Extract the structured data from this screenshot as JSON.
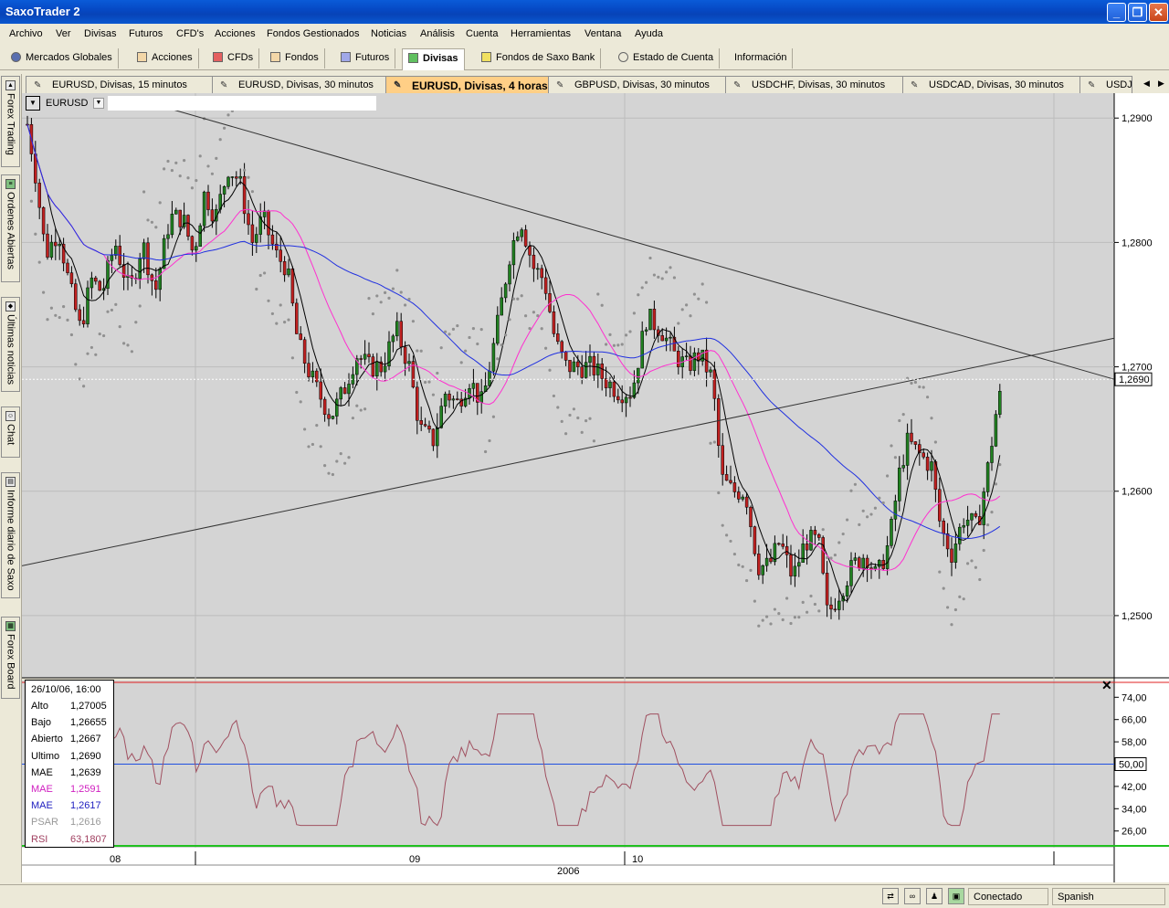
{
  "window": {
    "title": "SaxoTrader 2",
    "buttons": [
      "_",
      "❐",
      "✕"
    ]
  },
  "menu": [
    "Archivo",
    "Ver",
    "Divisas",
    "Futuros",
    "CFD's",
    "Acciones",
    "Fondos Gestionados",
    "Noticias",
    "Análisis",
    "Cuenta",
    "Herramientas",
    "Ventana",
    "Ayuda"
  ],
  "categories": [
    {
      "label": "Mercados Globales",
      "icon": "globe-icon",
      "color": "#5a6fb0"
    },
    {
      "label": "Acciones",
      "icon": "stocks-icon",
      "color": "#c08040"
    },
    {
      "label": "CFDs",
      "icon": "cfd-icon",
      "color": "#d04040"
    },
    {
      "label": "Fondos",
      "icon": "funds-icon",
      "color": "#c08040"
    },
    {
      "label": "Futuros",
      "icon": "futures-icon",
      "color": "#4050c0"
    },
    {
      "label": "Divisas",
      "icon": "forex-icon",
      "color": "#30a030",
      "active": true
    },
    {
      "label": "Fondos de Saxo Bank",
      "icon": "saxo-funds-icon",
      "color": "#d0c040"
    },
    {
      "label": "Estado de Cuenta",
      "icon": "account-icon",
      "color": "#555555"
    },
    {
      "label": "Información",
      "icon": "",
      "color": ""
    }
  ],
  "chart_tabs": [
    {
      "label": "EURUSD, Divisas, 15 minutos"
    },
    {
      "label": "EURUSD, Divisas, 30 minutos"
    },
    {
      "label": "EURUSD, Divisas, 4 horas",
      "active": true
    },
    {
      "label": "GBPUSD, Divisas, 30 minutos"
    },
    {
      "label": "USDCHF, Divisas, 30 minutos"
    },
    {
      "label": "USDCAD, Divisas, 30 minutos"
    },
    {
      "label": "USDJPY, Divisas, 30 minutos"
    }
  ],
  "side_tabs": [
    "Forex Trading",
    "Ordenes Abiertas",
    "Últimas noticias",
    "Chat",
    "Informe diario de Saxo",
    "Forex Board"
  ],
  "symbol": {
    "name": "EURUSD"
  },
  "info_panel": {
    "datetime": "26/10/06, 16:00",
    "rows": [
      {
        "label": "Alto",
        "value": "1,27005",
        "color": "#000000"
      },
      {
        "label": "Bajo",
        "value": "1,26655",
        "color": "#000000"
      },
      {
        "label": "Abierto",
        "value": "1,2667",
        "color": "#000000"
      },
      {
        "label": "Ultimo",
        "value": "1,2690",
        "color": "#000000"
      },
      {
        "label": "MAE",
        "value": "1,2639",
        "color": "#000000"
      },
      {
        "label": "MAE",
        "value": "1,2591",
        "color": "#d020c0"
      },
      {
        "label": "MAE",
        "value": "1,2617",
        "color": "#2020c0"
      },
      {
        "label": "PSAR",
        "value": "1,2616",
        "color": "#999999"
      },
      {
        "label": "RSI",
        "value": "63,1807",
        "color": "#a04060"
      }
    ]
  },
  "price_axis": {
    "ticks": [
      "1,2900",
      "1,2800",
      "1,2700",
      "1,2600",
      "1,2500"
    ],
    "current": "1,2690"
  },
  "rsi_axis": {
    "ticks": [
      "74,00",
      "66,00",
      "58,00",
      "42,00",
      "34,00",
      "26,00"
    ],
    "current": "50,00"
  },
  "time_axis": {
    "months": [
      "08",
      "09",
      "10"
    ],
    "year": "2006"
  },
  "colors": {
    "candle_up": "#208020",
    "candle_down": "#c02020",
    "ma_fast": "#000000",
    "ma_mid": "#ff30d0",
    "ma_slow": "#2030e0",
    "psar": "#909090",
    "rsi": "#a05060",
    "rsi_mid": "#2050e0",
    "rsi_top": "#e02020",
    "rsi_bottom": "#20c020"
  },
  "status": {
    "connection": "Conectado",
    "language": "Spanish"
  }
}
